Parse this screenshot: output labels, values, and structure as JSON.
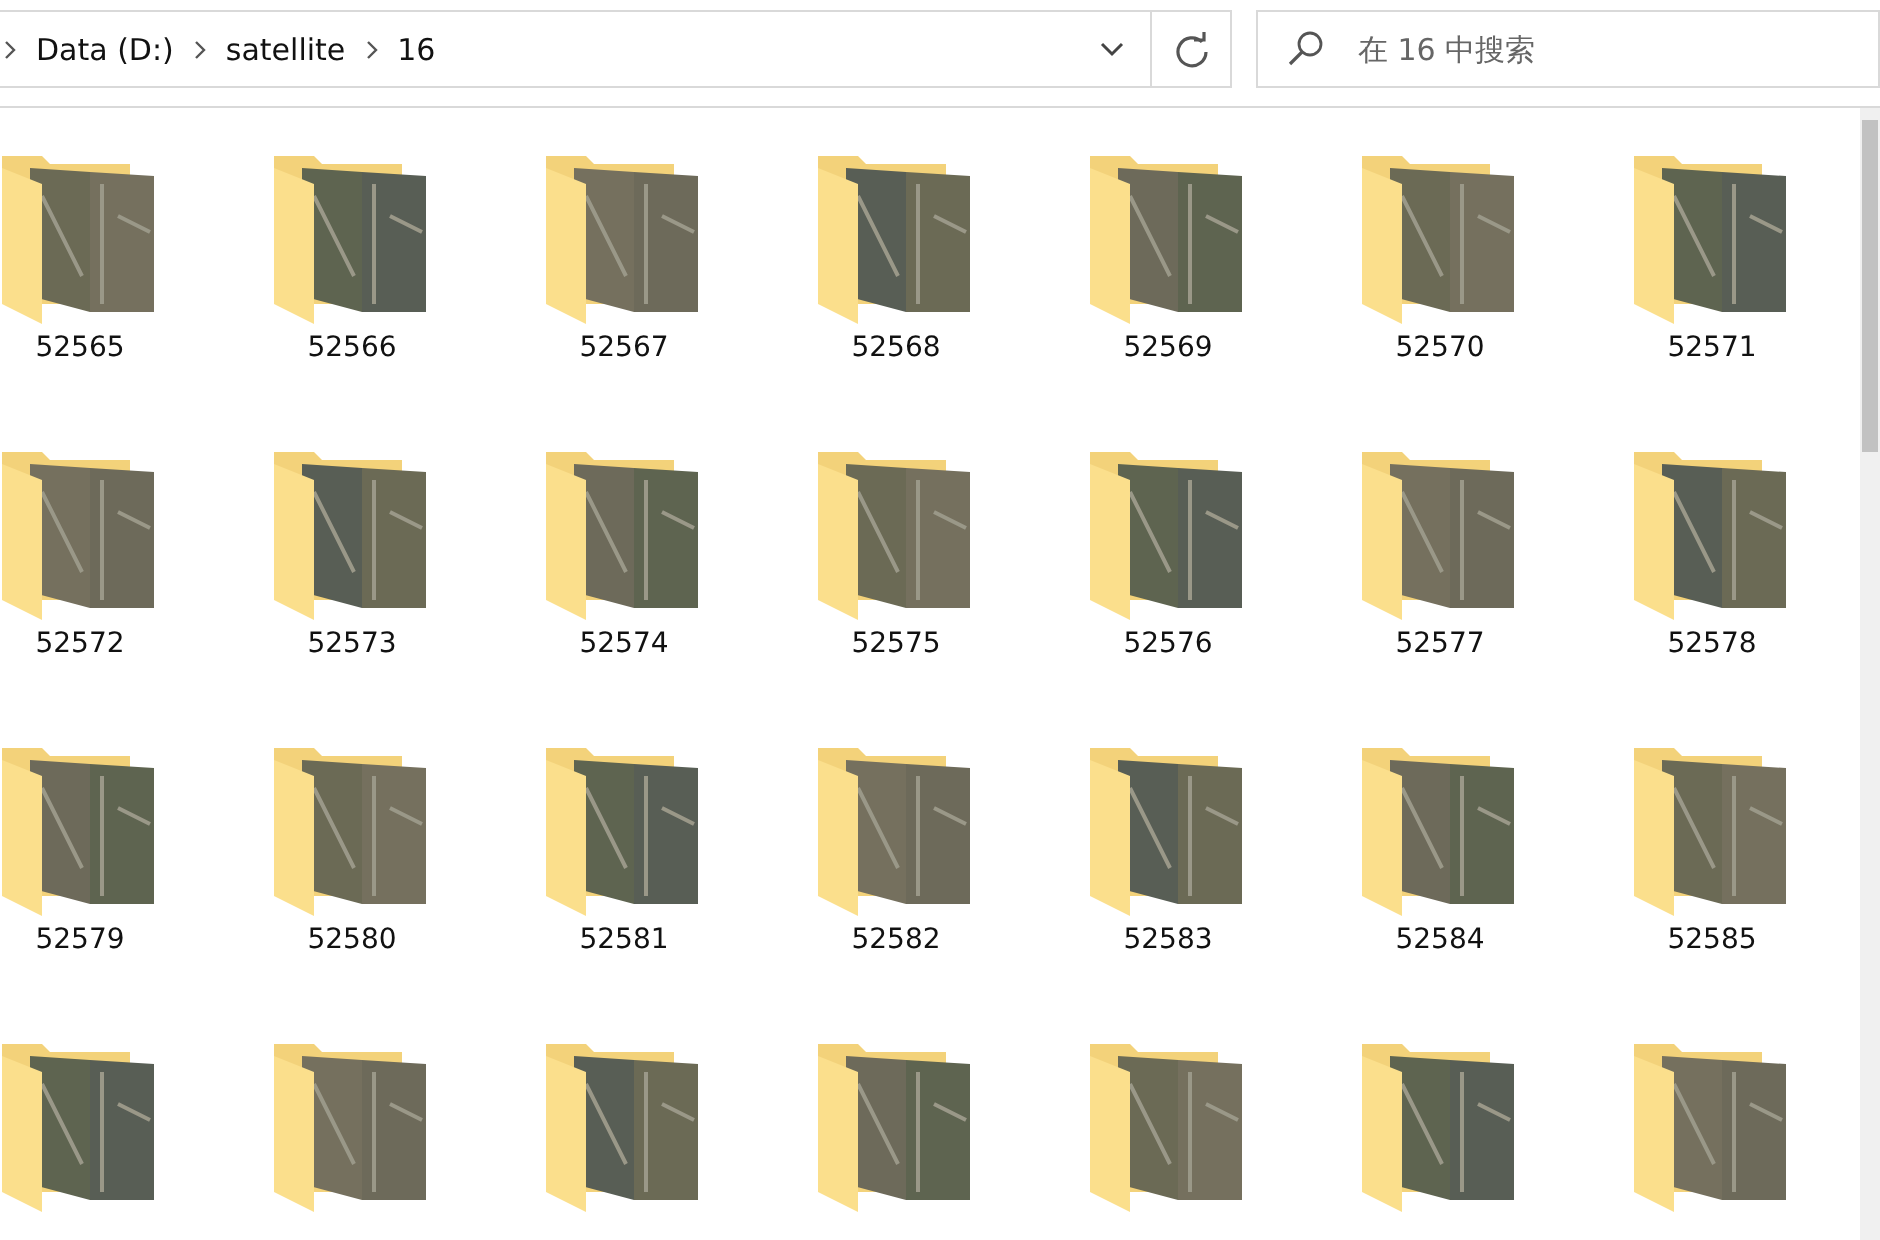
{
  "address_bar": {
    "path": [
      "Data (D:)",
      "satellite",
      "16"
    ]
  },
  "search": {
    "placeholder": "在 16 中搜索"
  },
  "items": [
    {
      "kind": "folder",
      "name": "52565"
    },
    {
      "kind": "folder",
      "name": "52566"
    },
    {
      "kind": "folder",
      "name": "52567"
    },
    {
      "kind": "folder",
      "name": "52568"
    },
    {
      "kind": "folder",
      "name": "52569"
    },
    {
      "kind": "folder",
      "name": "52570"
    },
    {
      "kind": "folder",
      "name": "52571"
    },
    {
      "kind": "folder",
      "name": "52572"
    },
    {
      "kind": "folder",
      "name": "52573"
    },
    {
      "kind": "folder",
      "name": "52574"
    },
    {
      "kind": "folder",
      "name": "52575"
    },
    {
      "kind": "folder",
      "name": "52576"
    },
    {
      "kind": "folder",
      "name": "52577"
    },
    {
      "kind": "folder",
      "name": "52578"
    },
    {
      "kind": "folder",
      "name": "52579"
    },
    {
      "kind": "folder",
      "name": "52580"
    },
    {
      "kind": "folder",
      "name": "52581"
    },
    {
      "kind": "folder",
      "name": "52582"
    },
    {
      "kind": "folder",
      "name": "52583"
    },
    {
      "kind": "folder",
      "name": "52584"
    },
    {
      "kind": "folder",
      "name": "52585"
    },
    {
      "kind": "folder"
    },
    {
      "kind": "folder"
    },
    {
      "kind": "folder"
    },
    {
      "kind": "folder"
    },
    {
      "kind": "folder"
    },
    {
      "kind": "folder"
    },
    {
      "kind": "folder"
    }
  ]
}
